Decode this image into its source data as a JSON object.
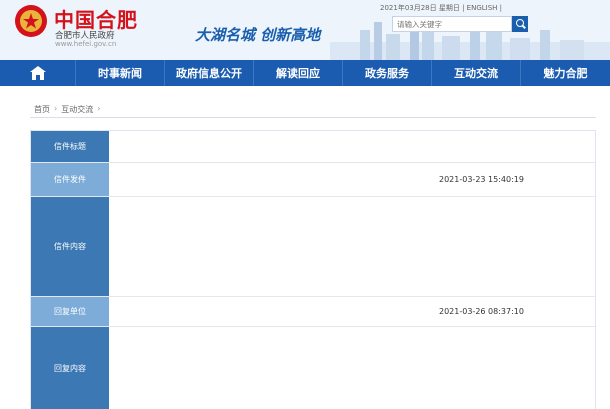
{
  "header": {
    "site_name": "中国合肥",
    "site_subtitle": "合肥市人民政府",
    "site_url": "www.hefei.gov.cn",
    "slogan": "大湖名城 创新高地",
    "topbar_text": "2021年03月28日 星期日 | ENGLISH |",
    "search_placeholder": "请输入关键字"
  },
  "nav": {
    "items": [
      {
        "label": "时事新闻"
      },
      {
        "label": "政府信息公开"
      },
      {
        "label": "解读回应"
      },
      {
        "label": "政务服务"
      },
      {
        "label": "互动交流"
      },
      {
        "label": "魅力合肥"
      }
    ]
  },
  "breadcrumb": {
    "home": "首页",
    "sep": "›",
    "level2": "互动交流"
  },
  "letter": {
    "title_label": "信件标题",
    "writer_label": "信件发件",
    "writer_time": "2021-03-23 15:40:19",
    "content_label": "信件内容",
    "reply_unit_label": "回复单位",
    "reply_unit_time": "2021-03-26 08:37:10",
    "reply_content_label": "回复内容"
  },
  "colors": {
    "brand_red": "#d3121b",
    "nav_blue": "#1c5cb0",
    "label_dark": "#3b78b4",
    "label_light": "#7dacd8"
  }
}
